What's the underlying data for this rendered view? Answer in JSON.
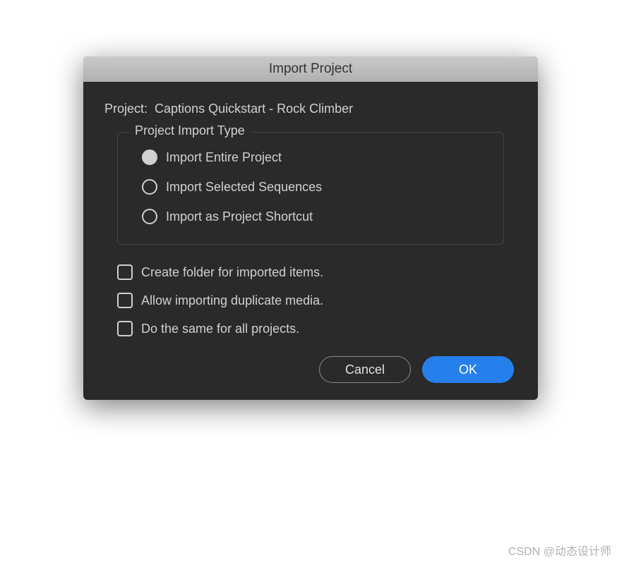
{
  "dialog": {
    "title": "Import Project",
    "project_label": "Project:",
    "project_name": "Captions Quickstart - Rock Climber",
    "fieldset_legend": "Project Import Type",
    "radio_options": [
      {
        "label": "Import Entire Project",
        "selected": true
      },
      {
        "label": "Import Selected Sequences",
        "selected": false
      },
      {
        "label": "Import as Project Shortcut",
        "selected": false
      }
    ],
    "checkboxes": [
      {
        "label": "Create folder for imported items.",
        "checked": false
      },
      {
        "label": "Allow importing duplicate media.",
        "checked": false
      },
      {
        "label": "Do the same for all projects.",
        "checked": false
      }
    ],
    "buttons": {
      "cancel": "Cancel",
      "ok": "OK"
    }
  },
  "watermark": "CSDN @动态设计师"
}
